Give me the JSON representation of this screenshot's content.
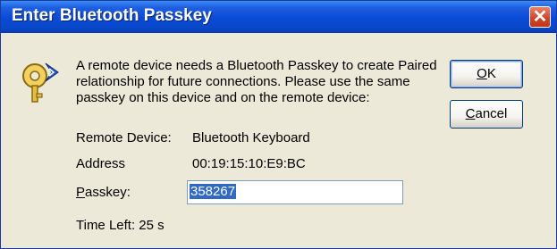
{
  "window": {
    "title": "Enter Bluetooth Passkey",
    "close_glyph": "✕"
  },
  "message": "A remote device needs a Bluetooth Passkey to create Paired relationship for future connections. Please use the same passkey on this device and on the remote device:",
  "fields": {
    "remote_device_label": "Remote Device:",
    "remote_device_value": "Bluetooth Keyboard",
    "address_label": "Address",
    "address_value": "00:19:15:10:E9:BC",
    "passkey_label_mnemonic": "P",
    "passkey_label_rest": "asskey:",
    "passkey_value": "358267"
  },
  "time_left": "Time Left: 25 s",
  "buttons": {
    "ok_mnemonic": "O",
    "ok_rest": "K",
    "cancel_mnemonic": "C",
    "cancel_rest": "ancel"
  },
  "icons": {
    "dialog_icon": "key-icon"
  },
  "colors": {
    "titlebar": "#0a47c9",
    "close": "#d2442a",
    "selection": "#316ac5",
    "face": "#ece9d8"
  }
}
